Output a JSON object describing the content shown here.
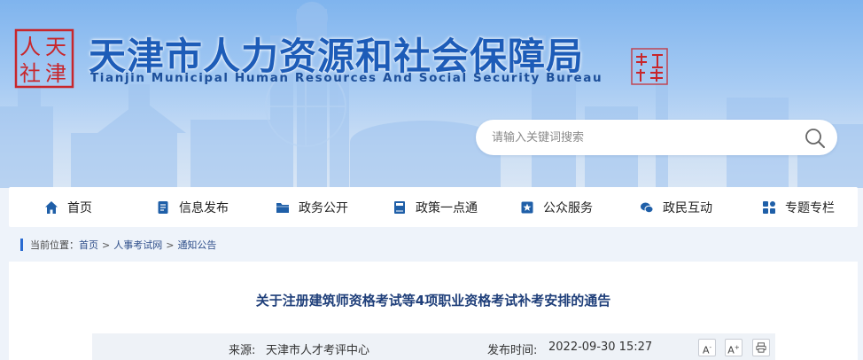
{
  "header": {
    "seal_chars": [
      "人",
      "天",
      "社",
      "津"
    ],
    "title": "天津市人力资源和社会保障局",
    "subtitle": "Tianjin Municipal Human Resources And Social Security Bureau"
  },
  "search": {
    "placeholder": "请输入关键词搜索",
    "icon": "search-icon"
  },
  "nav": {
    "items": [
      {
        "label": "首页",
        "icon": "home-icon"
      },
      {
        "label": "信息发布",
        "icon": "document-icon"
      },
      {
        "label": "政务公开",
        "icon": "folder-icon"
      },
      {
        "label": "政策一点通",
        "icon": "book-icon"
      },
      {
        "label": "公众服务",
        "icon": "star-badge-icon"
      },
      {
        "label": "政民互动",
        "icon": "chat-icon"
      },
      {
        "label": "专题专栏",
        "icon": "grid-icon"
      }
    ]
  },
  "breadcrumb": {
    "label": "当前位置：",
    "items": [
      "首页",
      "人事考试网",
      "通知公告"
    ],
    "separator": ">"
  },
  "article": {
    "title": "关于注册建筑师资格考试等4项职业资格考试补考安排的通告",
    "source_label": "来源:",
    "source_value": "天津市人才考评中心",
    "date_label": "发布时间:",
    "date_value": "2022-09-30 15:27",
    "font_larger": "A",
    "font_smaller": "A",
    "font_larger_mark": "+",
    "font_smaller_mark": "-",
    "print_icon": "print-icon"
  },
  "colors": {
    "brand_blue": "#1d5cb8",
    "nav_icon": "#1f5fa8",
    "title_blue": "#1f3f7a",
    "seal_red": "#c8262b"
  }
}
